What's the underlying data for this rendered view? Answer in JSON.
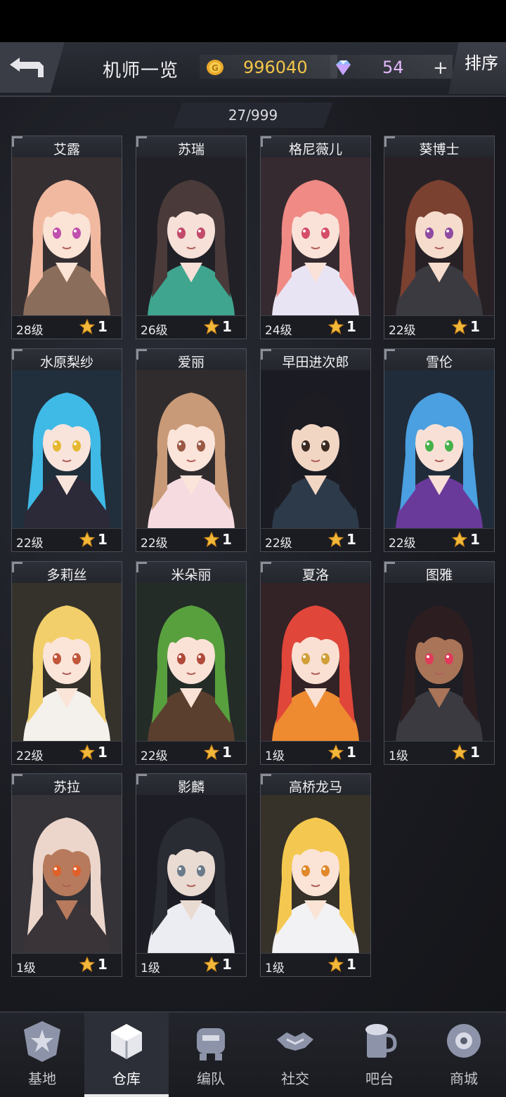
{
  "header": {
    "title": "机师一览",
    "coins": "996040",
    "gems": "54",
    "plus_label": "+",
    "sort_label": "排序"
  },
  "roster_count": "27/999",
  "pilots": [
    {
      "name": "艾露",
      "level": "28级",
      "stars": "1",
      "hair": "#f1b9a0",
      "skin": "#fbe3d6",
      "outfit": "#8a6d5a",
      "eyes": "#c04fae"
    },
    {
      "name": "苏瑞",
      "level": "26级",
      "stars": "1",
      "hair": "#4a3b3a",
      "skin": "#f6e0d8",
      "outfit": "#3fa58f",
      "eyes": "#c24a6a"
    },
    {
      "name": "格尼薇儿",
      "level": "24级",
      "stars": "1",
      "hair": "#ef8a84",
      "skin": "#fbe2d8",
      "outfit": "#e9e4f4",
      "eyes": "#d54d6a"
    },
    {
      "name": "葵博士",
      "level": "22级",
      "stars": "1",
      "hair": "#7a4030",
      "skin": "#f6dccc",
      "outfit": "#3a3a40",
      "eyes": "#8e4aa0"
    },
    {
      "name": "水原梨纱",
      "level": "22级",
      "stars": "1",
      "hair": "#3fb9e6",
      "skin": "#f9e4dc",
      "outfit": "#2c2a38",
      "eyes": "#e6b832"
    },
    {
      "name": "爱丽",
      "level": "22级",
      "stars": "1",
      "hair": "#c99a78",
      "skin": "#fbe4da",
      "outfit": "#f6dce0",
      "eyes": "#9a5a44"
    },
    {
      "name": "早田进次郎",
      "level": "22级",
      "stars": "1",
      "hair": "#1c1c22",
      "skin": "#f2d6c4",
      "outfit": "#2d3a4a",
      "eyes": "#3a2a22"
    },
    {
      "name": "雪伦",
      "level": "22级",
      "stars": "1",
      "hair": "#4aa0e0",
      "skin": "#f9e0d6",
      "outfit": "#6a3a9a",
      "eyes": "#46b04a"
    },
    {
      "name": "多莉丝",
      "level": "22级",
      "stars": "1",
      "hair": "#f2cf6a",
      "skin": "#fbe5d8",
      "outfit": "#f4f0ec",
      "eyes": "#c0563a"
    },
    {
      "name": "米朵丽",
      "level": "22级",
      "stars": "1",
      "hair": "#58a03e",
      "skin": "#fbe2d6",
      "outfit": "#5a3e2e",
      "eyes": "#b04a3a"
    },
    {
      "name": "夏洛",
      "level": "1级",
      "stars": "1",
      "hair": "#e0463a",
      "skin": "#fae0d2",
      "outfit": "#ee8a30",
      "eyes": "#d2a03a"
    },
    {
      "name": "图雅",
      "level": "1级",
      "stars": "1",
      "hair": "#2c1e20",
      "skin": "#a97458",
      "outfit": "#3a3a40",
      "eyes": "#e03a5a"
    },
    {
      "name": "苏拉",
      "level": "1级",
      "stars": "1",
      "hair": "#ecd6cc",
      "skin": "#b77a5c",
      "outfit": "#3a3438",
      "eyes": "#e0602a"
    },
    {
      "name": "影麟",
      "level": "1级",
      "stars": "1",
      "hair": "#2a2c34",
      "skin": "#eadbd2",
      "outfit": "#ecedf2",
      "eyes": "#6a7a8a"
    },
    {
      "name": "高桥龙马",
      "level": "1级",
      "stars": "1",
      "hair": "#f4c850",
      "skin": "#fbe3d6",
      "outfit": "#f2f2f4",
      "eyes": "#e0882a"
    }
  ],
  "nav": [
    {
      "label": "基地",
      "icon": "base-emblem-icon",
      "active": false
    },
    {
      "label": "仓库",
      "icon": "warehouse-crate-icon",
      "active": true
    },
    {
      "label": "编队",
      "icon": "squad-mech-icon",
      "active": false
    },
    {
      "label": "社交",
      "icon": "handshake-icon",
      "active": false
    },
    {
      "label": "吧台",
      "icon": "beer-mug-icon",
      "active": false
    },
    {
      "label": "商城",
      "icon": "shop-orb-icon",
      "active": false
    }
  ]
}
